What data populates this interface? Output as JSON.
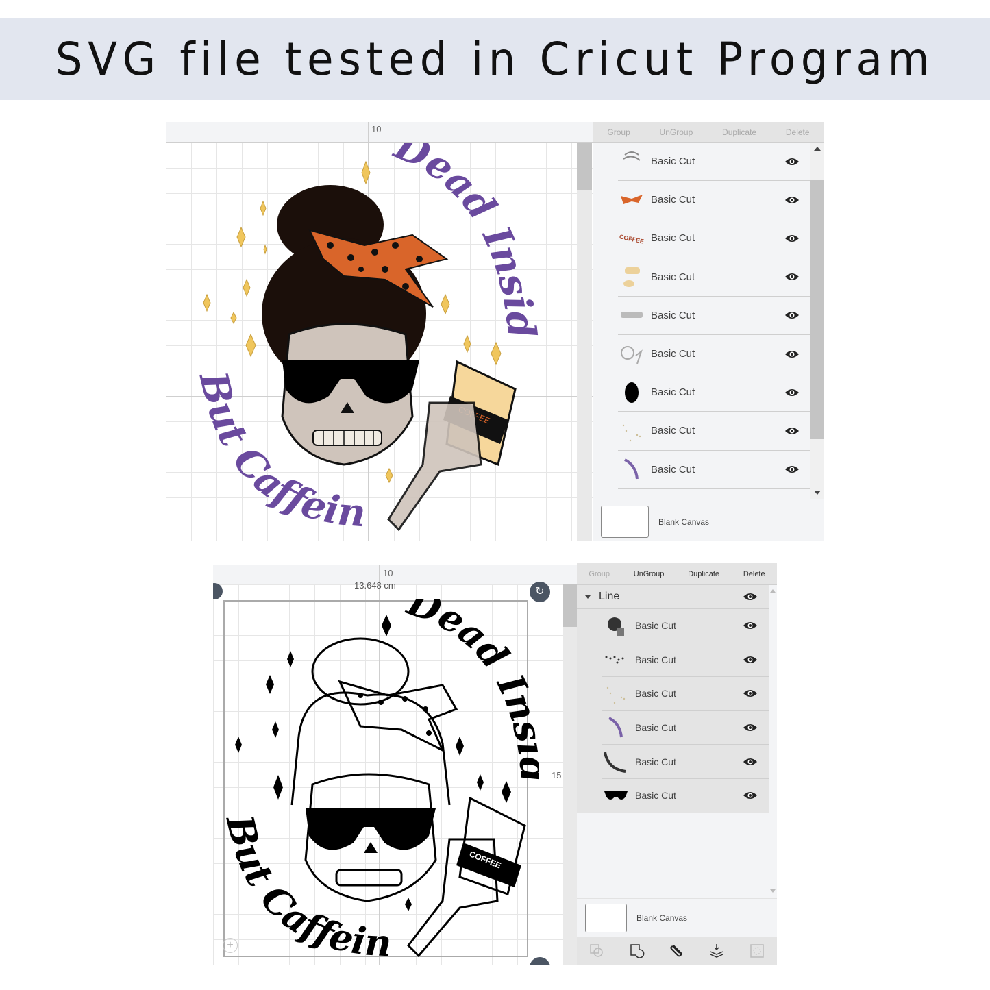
{
  "banner": {
    "title": "SVG file tested in Cricut Program"
  },
  "top_screen": {
    "ruler_label": "10",
    "toolbar": [
      "Group",
      "UnGroup",
      "Duplicate",
      "Delete"
    ],
    "layers": [
      {
        "label": "Basic Cut",
        "thumb": "hair-strands"
      },
      {
        "label": "Basic Cut",
        "thumb": "orange-bow"
      },
      {
        "label": "Basic Cut",
        "thumb": "coffee-text"
      },
      {
        "label": "Basic Cut",
        "thumb": "cup-lid"
      },
      {
        "label": "Basic Cut",
        "thumb": "teeth"
      },
      {
        "label": "Basic Cut",
        "thumb": "skull-hand"
      },
      {
        "label": "Basic Cut",
        "thumb": "hair-bun-silhouette"
      },
      {
        "label": "Basic Cut",
        "thumb": "sparkles"
      },
      {
        "label": "Basic Cut",
        "thumb": "dead-inside-text"
      }
    ],
    "blank_canvas": "Blank Canvas",
    "artwork": {
      "text_top": "Dead Inside",
      "text_bottom": "But Caffeinated",
      "cup_text": "COFFEE"
    },
    "colors": {
      "purple": "#6a4a9e",
      "orange": "#d9652a",
      "gold": "#f0c65c",
      "bone": "#cfc4bb",
      "hair": "#2a1a12",
      "cup": "#f6d79b"
    }
  },
  "bottom_screen": {
    "ruler_label": "10",
    "width_readout": "13.648 cm",
    "side_ruler_label": "15",
    "toolbar": [
      "Group",
      "UnGroup",
      "Duplicate",
      "Delete"
    ],
    "group": {
      "label": "Line"
    },
    "layers": [
      {
        "label": "Basic Cut",
        "thumb": "full-design"
      },
      {
        "label": "Basic Cut",
        "thumb": "polka-dots"
      },
      {
        "label": "Basic Cut",
        "thumb": "sparkles"
      },
      {
        "label": "Basic Cut",
        "thumb": "dead-inside-text"
      },
      {
        "label": "Basic Cut",
        "thumb": "but-caffeinated-text"
      },
      {
        "label": "Basic Cut",
        "thumb": "sunglasses"
      }
    ],
    "blank_canvas": "Blank Canvas",
    "artwork": {
      "text_top": "Dead Inside",
      "text_bottom": "But Caffeinated",
      "cup_text": "COFFEE"
    },
    "bottom_tools": [
      "slice-icon",
      "weld-icon",
      "attach-icon",
      "flatten-icon",
      "contour-icon"
    ]
  }
}
